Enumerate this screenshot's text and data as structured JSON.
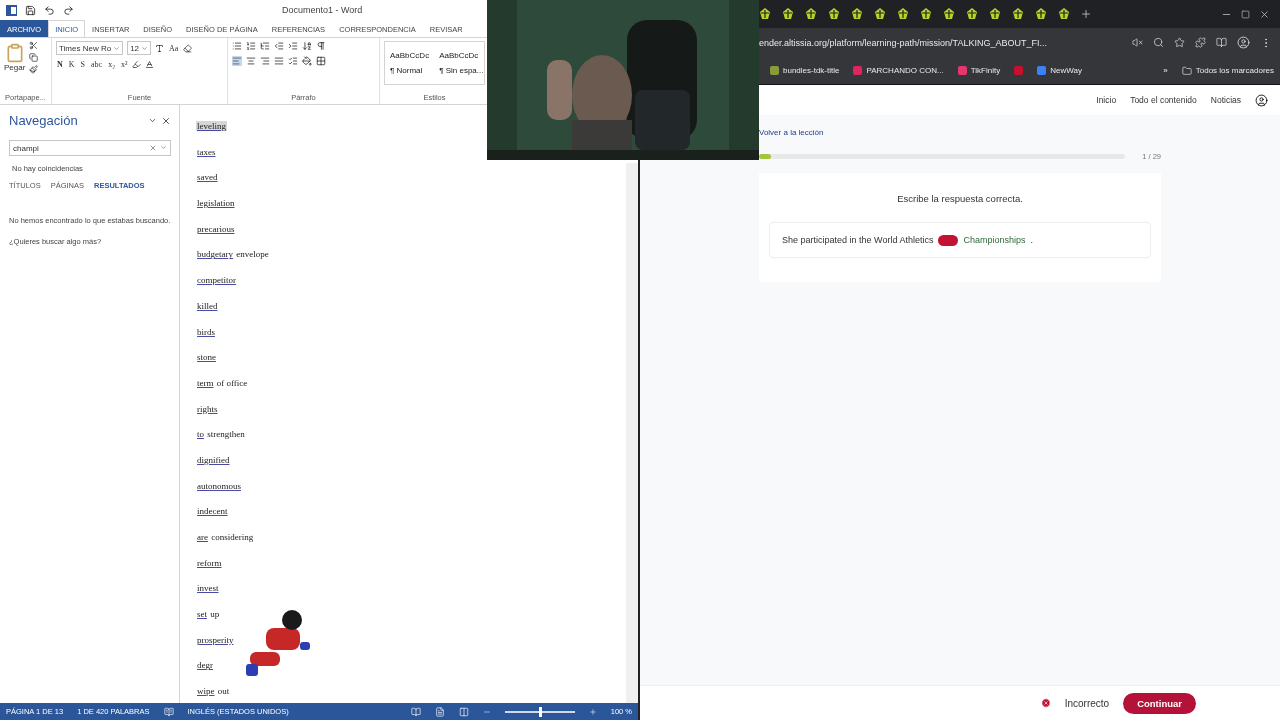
{
  "word": {
    "title": "Documento1 - Word",
    "tabs": [
      {
        "label": "ARCHIVO",
        "kind": "file",
        "selected": false
      },
      {
        "label": "INICIO",
        "kind": "tab",
        "selected": true
      },
      {
        "label": "INSERTAR",
        "kind": "tab",
        "selected": false
      },
      {
        "label": "DISEÑO",
        "kind": "tab",
        "selected": false
      },
      {
        "label": "DISEÑO DE PÁGINA",
        "kind": "tab",
        "selected": false
      },
      {
        "label": "REFERENCIAS",
        "kind": "tab",
        "selected": false
      },
      {
        "label": "CORRESPONDENCIA",
        "kind": "tab",
        "selected": false
      },
      {
        "label": "REVISAR",
        "kind": "tab",
        "selected": false
      }
    ],
    "ribbon": {
      "paste_label": "Pegar",
      "font_name": "Times New Ro",
      "font_size": "12",
      "case_button": "Aa",
      "format_buttons": [
        "N",
        "K",
        "S",
        "abc",
        "x₂",
        "x²"
      ],
      "styles": [
        {
          "preview": "AaBbCcDc",
          "name": "¶ Normal"
        },
        {
          "preview": "AaBbCcDc",
          "name": "¶ Sin espa..."
        }
      ],
      "groups": [
        "Portapape...",
        "Fuente",
        "Párrafo",
        "Estilos"
      ]
    },
    "navigation": {
      "title": "Navegación",
      "search": {
        "value": "champi"
      },
      "status": "No hay coincidencias",
      "tabs": [
        {
          "label": "TÍTULOS",
          "selected": false
        },
        {
          "label": "PÁGINAS",
          "selected": false
        },
        {
          "label": "RESULTADOS",
          "selected": true
        }
      ],
      "message": "No hemos encontrado lo que estabas buscando.",
      "hint": "¿Quieres buscar algo más?"
    },
    "document": {
      "entries": [
        {
          "underlined": "leveling",
          "highlighted": true
        },
        {
          "underlined": "taxes",
          "highlighted": false
        },
        {
          "underlined": "saved",
          "highlighted": false
        },
        {
          "underlined": "legislation",
          "highlighted": false
        },
        {
          "underlined": "precarious",
          "highlighted": false
        },
        {
          "underlined": "budgetary",
          "rest": "envelope",
          "highlighted": false
        },
        {
          "underlined": "competitor",
          "highlighted": false
        },
        {
          "underlined": "killed",
          "highlighted": false
        },
        {
          "underlined": "birds",
          "highlighted": false
        },
        {
          "underlined": "stone",
          "highlighted": false
        },
        {
          "underlined": "term",
          "rest": "of office",
          "highlighted": false
        },
        {
          "underlined": "rights",
          "highlighted": false
        },
        {
          "underlined": "to",
          "rest": "strengthen",
          "highlighted": false
        },
        {
          "underlined": "dignified",
          "highlighted": false
        },
        {
          "underlined": "autonomous",
          "highlighted": false
        },
        {
          "underlined": "indecent",
          "highlighted": false
        },
        {
          "underlined": "are",
          "rest": "considering",
          "highlighted": false
        },
        {
          "underlined": "reform",
          "highlighted": false
        },
        {
          "underlined": "invest",
          "highlighted": false
        },
        {
          "underlined": "set",
          "rest": "up",
          "highlighted": false
        },
        {
          "underlined": "prosperity",
          "highlighted": false
        },
        {
          "underlined": "degr",
          "highlighted": false
        },
        {
          "underlined": "wipe",
          "rest": "out",
          "highlighted": false
        }
      ]
    },
    "status_bar": {
      "page": "PÁGINA 1 DE 13",
      "words": "1 DE 420 PALABRAS",
      "language": "INGLÉS (ESTADOS UNIDOS)",
      "zoom": "100 %",
      "zoom_slider": {
        "level": 0.5
      }
    }
  },
  "browser": {
    "url": "ender.altissia.org/platform/learning-path/mission/TALKING_ABOUT_FI...",
    "bookmarks": [
      {
        "label": "bundles-tdk-title",
        "color": "#8a9a3a"
      },
      {
        "label": "PARCHANDO CON...",
        "color": "#e0245e"
      },
      {
        "label": "TikFinity",
        "color": "#e8356b"
      },
      {
        "color": "#c8102e"
      },
      {
        "label": "NewWay",
        "color": "#3b82f6"
      }
    ],
    "more": "»",
    "all_bookmarks": "Todos los marcadores",
    "nav": [
      "Inicio",
      "Todo el contenido",
      "Noticias"
    ],
    "back_link": "Volver a la lección",
    "progress": {
      "level": 0.034,
      "reading": "1 / 29"
    },
    "instruction": "Escribe la respuesta correcta.",
    "sentence": {
      "before": "She participated in the World Athletics",
      "answer_incorrect": true,
      "after": "Championships",
      "end": "."
    },
    "result": "Incorrecto",
    "continue": "Continuar"
  }
}
